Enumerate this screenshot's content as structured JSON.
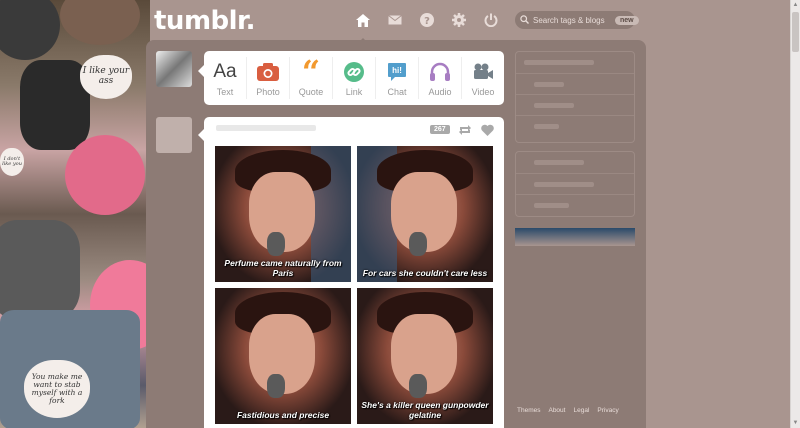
{
  "header": {
    "logo": "tumblr.",
    "nav": [
      {
        "name": "dashboard-icon",
        "active": true
      },
      {
        "name": "messages-icon",
        "active": false
      },
      {
        "name": "help-icon",
        "active": false
      },
      {
        "name": "settings-icon",
        "active": false
      },
      {
        "name": "logout-icon",
        "active": false
      }
    ],
    "search": {
      "placeholder": "Search tags & blogs",
      "badge": "new"
    }
  },
  "collage": {
    "hearts": [
      "I like your ass",
      "I don't like you",
      "You make me want to stab myself with a fork"
    ]
  },
  "compose": {
    "types": [
      {
        "label": "Text",
        "icon": "text-icon",
        "color": "#444444"
      },
      {
        "label": "Photo",
        "icon": "camera-icon",
        "color": "#d95e40"
      },
      {
        "label": "Quote",
        "icon": "quote-icon",
        "color": "#f2992e"
      },
      {
        "label": "Link",
        "icon": "link-icon",
        "color": "#56bc8a"
      },
      {
        "label": "Chat",
        "icon": "chat-icon",
        "color": "#529ecc"
      },
      {
        "label": "Audio",
        "icon": "headphones-icon",
        "color": "#a77dc2"
      },
      {
        "label": "Video",
        "icon": "video-camera-icon",
        "color": "#748089"
      }
    ]
  },
  "post": {
    "notes": "267",
    "captions": [
      "Perfume came naturally from Paris",
      "For cars she couldn't care less",
      "Fastidious and precise",
      "She's a killer queen gunpowder gelatine"
    ]
  },
  "footer": {
    "links": [
      "Themes",
      "About",
      "Legal",
      "Privacy"
    ]
  },
  "colors": {
    "background": "#a9958f",
    "panel": "#8d7b75",
    "accent_blue": "#529ecc"
  }
}
